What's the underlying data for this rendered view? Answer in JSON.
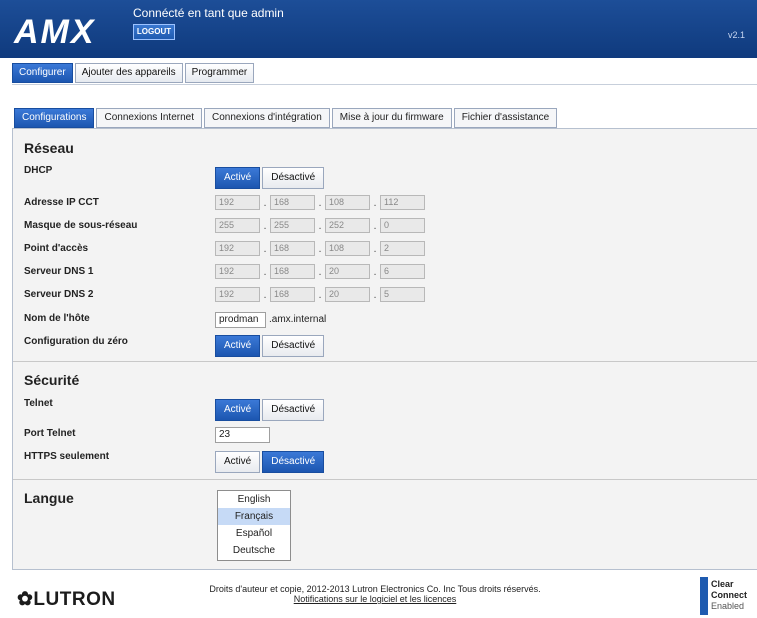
{
  "header": {
    "brand": "AMX",
    "status": "Connécté en tant que admin",
    "logout_label": "LOGOUT",
    "version": "v2.1"
  },
  "top_tabs": [
    "Configurer",
    "Ajouter des appareils",
    "Programmer"
  ],
  "sub_tabs": [
    "Configurations",
    "Connexions Internet",
    "Connexions d'intégration",
    "Mise à jour du firmware",
    "Fichier d'assistance"
  ],
  "reseau": {
    "title": "Réseau",
    "dhcp": {
      "label": "DHCP",
      "on": "Activé",
      "off": "Désactivé"
    },
    "ip_cct": {
      "label": "Adresse IP CCT",
      "octets": [
        "192",
        "168",
        "108",
        "112"
      ]
    },
    "subnet": {
      "label": "Masque de sous-réseau",
      "octets": [
        "255",
        "255",
        "252",
        "0"
      ]
    },
    "gateway": {
      "label": "Point d'accès",
      "octets": [
        "192",
        "168",
        "108",
        "2"
      ]
    },
    "dns1": {
      "label": "Serveur DNS 1",
      "octets": [
        "192",
        "168",
        "20",
        "6"
      ]
    },
    "dns2": {
      "label": "Serveur DNS 2",
      "octets": [
        "192",
        "168",
        "20",
        "5"
      ]
    },
    "hostname": {
      "label": "Nom de l'hôte",
      "value": "prodman",
      "suffix": ".amx.internal"
    },
    "zeroconf": {
      "label": "Configuration du zéro",
      "on": "Activé",
      "off": "Désactivé"
    }
  },
  "securite": {
    "title": "Sécurité",
    "telnet": {
      "label": "Telnet",
      "on": "Activé",
      "off": "Désactivé"
    },
    "telnet_port": {
      "label": "Port Telnet",
      "value": "23"
    },
    "https": {
      "label": "HTTPS seulement",
      "on": "Activé",
      "off": "Désactivé"
    }
  },
  "langue": {
    "title": "Langue",
    "options": [
      "English",
      "Français",
      "Español",
      "Deutsche"
    ],
    "selected": "Français"
  },
  "footer": {
    "brand": "LUTRON",
    "copyright": "Droits d'auteur et copie, 2012-2013 Lutron Electronics Co. Inc Tous droits réservés.",
    "link": "Notifications sur le logiciel et les licences",
    "badge": [
      "Clear",
      "Connect",
      "Enabled"
    ]
  },
  "colors": {
    "header_blue": "#0f3a7d",
    "active_blue": "#1c56b0"
  }
}
